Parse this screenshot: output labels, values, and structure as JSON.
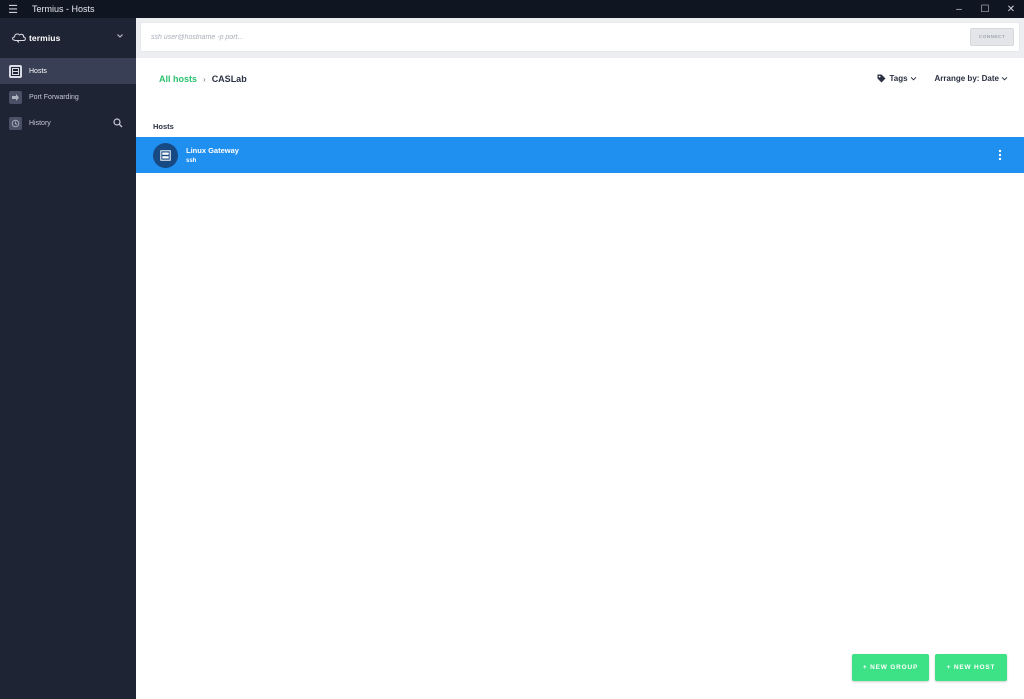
{
  "window": {
    "title": "Termius - Hosts",
    "menu_icon": "hamburger-icon",
    "controls": [
      "minimize-icon",
      "maximize-icon",
      "close-icon"
    ]
  },
  "sidebar": {
    "brand": {
      "name": "termius",
      "logo_icon": "termius-logo-icon",
      "dropdown_icon": "chevron-down-icon"
    },
    "items": [
      {
        "label": "Hosts",
        "icon": "hosts-grid-icon",
        "active": true
      },
      {
        "label": "Port Forwarding",
        "icon": "port-forward-arrow-icon",
        "active": false
      },
      {
        "label": "History",
        "icon": "history-clock-icon",
        "active": false,
        "action_icon": "search-icon"
      }
    ]
  },
  "topbar": {
    "ssh_placeholder": "ssh user@hostname -p port...",
    "ssh_value": "",
    "connect_label": "CONNECT"
  },
  "breadcrumb": {
    "root": "All hosts",
    "separator": "›",
    "current": "CASLab"
  },
  "controls": {
    "tags_label": "Tags",
    "arrange_label": "Arrange by: Date"
  },
  "hosts_section": {
    "title": "Hosts",
    "items": [
      {
        "name": "Linux Gateway",
        "subtitle": "ssh",
        "icon": "server-icon",
        "selected": true,
        "menu_icon": "more-vertical-icon"
      }
    ]
  },
  "actions": {
    "new_group": "+ NEW GROUP",
    "new_host": "+ NEW HOST"
  },
  "colors": {
    "sidebar_bg": "#1f2434",
    "active_item_bg": "#394055",
    "accent_green": "#3ee286",
    "link_green": "#2cc16e",
    "selected_row_blue": "#1f8ff0",
    "avatar_bg": "#174a82"
  }
}
